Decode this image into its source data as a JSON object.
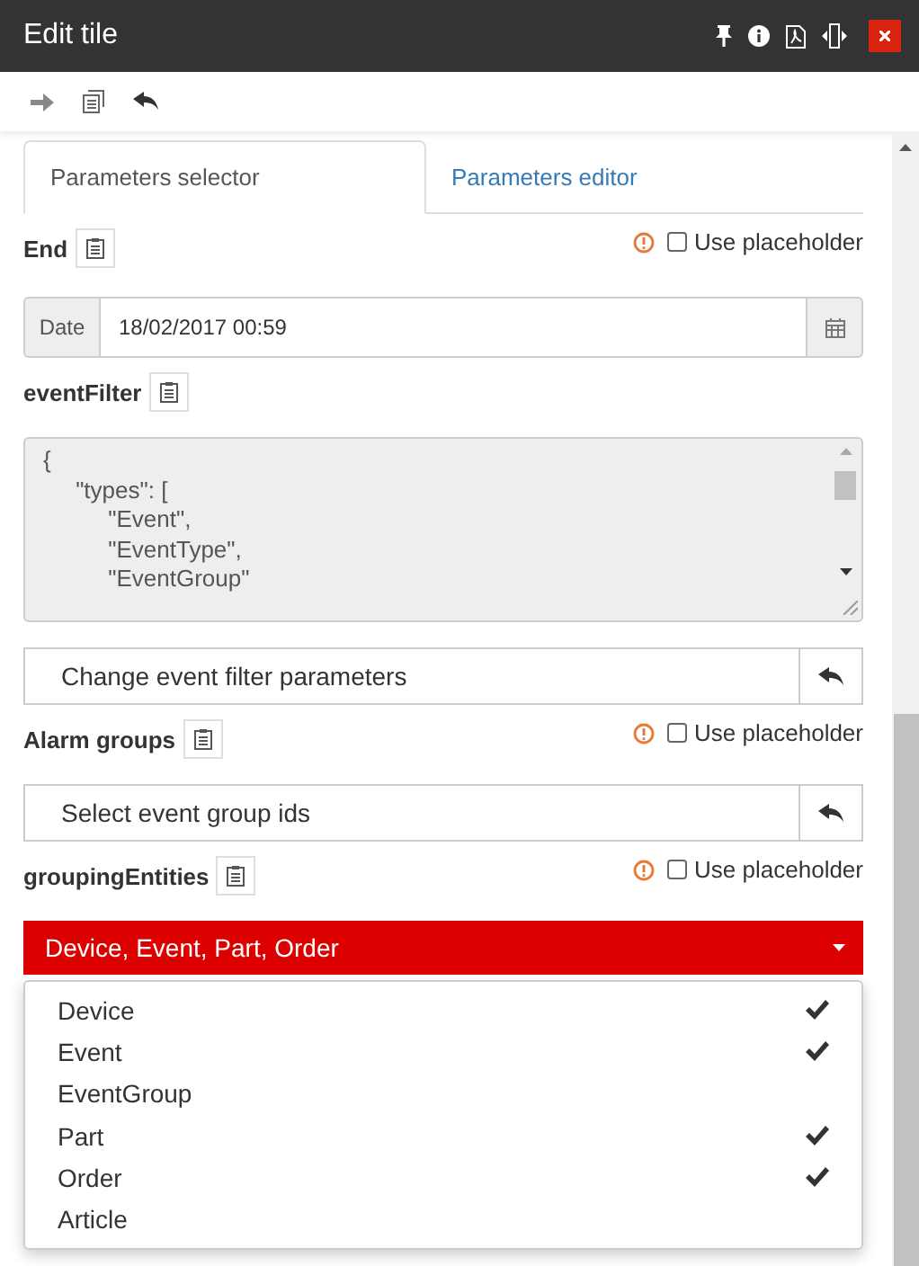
{
  "window": {
    "title": "Edit tile"
  },
  "tabs": [
    {
      "label": "Parameters selector",
      "selected": true
    },
    {
      "label": "Parameters editor",
      "selected": false
    }
  ],
  "sections": [
    {
      "kind": "header",
      "label": "End",
      "use_placeholder": {
        "label": "Use placeholder",
        "checked": false
      }
    },
    {
      "kind": "date",
      "addon": "Date",
      "value": "18/02/2017 00:59"
    },
    {
      "kind": "header",
      "label": "eventFilter"
    },
    {
      "kind": "code",
      "lines": [
        "{",
        "\t\"types\": [",
        "\t\t\"Event\",",
        "\t\t\"EventType\",",
        "\t\t\"EventGroup\""
      ]
    },
    {
      "kind": "action",
      "label": "Change event filter parameters"
    },
    {
      "kind": "header",
      "label": "Alarm groups",
      "use_placeholder": {
        "label": "Use placeholder",
        "checked": false
      }
    },
    {
      "kind": "action",
      "label": "Select event group ids"
    },
    {
      "kind": "header",
      "label": "groupingEntities",
      "use_placeholder": {
        "label": "Use placeholder",
        "checked": false
      }
    },
    {
      "kind": "multiselect",
      "value": "Device, Event, Part, Order",
      "expanded": true,
      "options": [
        {
          "label": "Device",
          "selected": true
        },
        {
          "label": "Event",
          "selected": true
        },
        {
          "label": "EventGroup",
          "selected": false
        },
        {
          "label": "Part",
          "selected": true
        },
        {
          "label": "Order",
          "selected": true
        },
        {
          "label": "Article",
          "selected": false
        }
      ]
    }
  ]
}
